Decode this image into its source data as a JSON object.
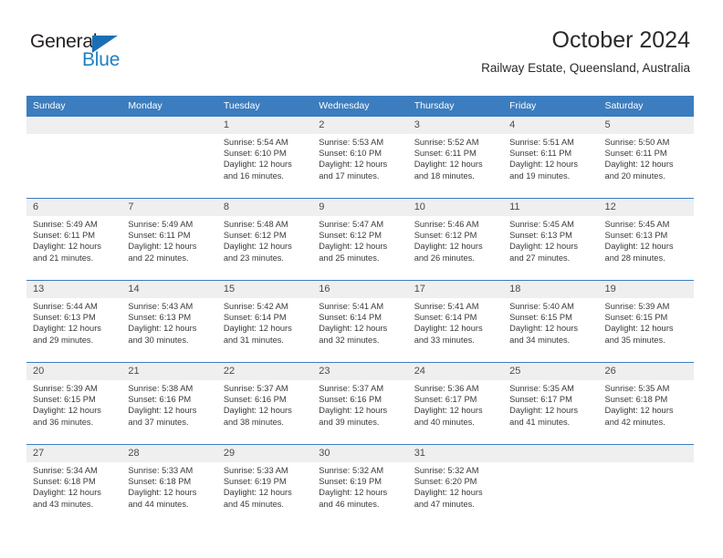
{
  "logo": {
    "word1": "General",
    "word2": "Blue",
    "triangle_color": "#1a6fb4",
    "word2_color": "#1f7fc4"
  },
  "header": {
    "title": "October 2024",
    "subtitle": "Railway Estate, Queensland, Australia"
  },
  "theme": {
    "header_bg": "#3c7dbf",
    "header_text": "#ffffff",
    "daynum_bg": "#efefef",
    "row_border": "#3c7dbf"
  },
  "weekdays": [
    "Sunday",
    "Monday",
    "Tuesday",
    "Wednesday",
    "Thursday",
    "Friday",
    "Saturday"
  ],
  "weeks": [
    [
      {
        "day": "",
        "lines": []
      },
      {
        "day": "",
        "lines": []
      },
      {
        "day": "1",
        "lines": [
          "Sunrise: 5:54 AM",
          "Sunset: 6:10 PM",
          "Daylight: 12 hours",
          "and 16 minutes."
        ]
      },
      {
        "day": "2",
        "lines": [
          "Sunrise: 5:53 AM",
          "Sunset: 6:10 PM",
          "Daylight: 12 hours",
          "and 17 minutes."
        ]
      },
      {
        "day": "3",
        "lines": [
          "Sunrise: 5:52 AM",
          "Sunset: 6:11 PM",
          "Daylight: 12 hours",
          "and 18 minutes."
        ]
      },
      {
        "day": "4",
        "lines": [
          "Sunrise: 5:51 AM",
          "Sunset: 6:11 PM",
          "Daylight: 12 hours",
          "and 19 minutes."
        ]
      },
      {
        "day": "5",
        "lines": [
          "Sunrise: 5:50 AM",
          "Sunset: 6:11 PM",
          "Daylight: 12 hours",
          "and 20 minutes."
        ]
      }
    ],
    [
      {
        "day": "6",
        "lines": [
          "Sunrise: 5:49 AM",
          "Sunset: 6:11 PM",
          "Daylight: 12 hours",
          "and 21 minutes."
        ]
      },
      {
        "day": "7",
        "lines": [
          "Sunrise: 5:49 AM",
          "Sunset: 6:11 PM",
          "Daylight: 12 hours",
          "and 22 minutes."
        ]
      },
      {
        "day": "8",
        "lines": [
          "Sunrise: 5:48 AM",
          "Sunset: 6:12 PM",
          "Daylight: 12 hours",
          "and 23 minutes."
        ]
      },
      {
        "day": "9",
        "lines": [
          "Sunrise: 5:47 AM",
          "Sunset: 6:12 PM",
          "Daylight: 12 hours",
          "and 25 minutes."
        ]
      },
      {
        "day": "10",
        "lines": [
          "Sunrise: 5:46 AM",
          "Sunset: 6:12 PM",
          "Daylight: 12 hours",
          "and 26 minutes."
        ]
      },
      {
        "day": "11",
        "lines": [
          "Sunrise: 5:45 AM",
          "Sunset: 6:13 PM",
          "Daylight: 12 hours",
          "and 27 minutes."
        ]
      },
      {
        "day": "12",
        "lines": [
          "Sunrise: 5:45 AM",
          "Sunset: 6:13 PM",
          "Daylight: 12 hours",
          "and 28 minutes."
        ]
      }
    ],
    [
      {
        "day": "13",
        "lines": [
          "Sunrise: 5:44 AM",
          "Sunset: 6:13 PM",
          "Daylight: 12 hours",
          "and 29 minutes."
        ]
      },
      {
        "day": "14",
        "lines": [
          "Sunrise: 5:43 AM",
          "Sunset: 6:13 PM",
          "Daylight: 12 hours",
          "and 30 minutes."
        ]
      },
      {
        "day": "15",
        "lines": [
          "Sunrise: 5:42 AM",
          "Sunset: 6:14 PM",
          "Daylight: 12 hours",
          "and 31 minutes."
        ]
      },
      {
        "day": "16",
        "lines": [
          "Sunrise: 5:41 AM",
          "Sunset: 6:14 PM",
          "Daylight: 12 hours",
          "and 32 minutes."
        ]
      },
      {
        "day": "17",
        "lines": [
          "Sunrise: 5:41 AM",
          "Sunset: 6:14 PM",
          "Daylight: 12 hours",
          "and 33 minutes."
        ]
      },
      {
        "day": "18",
        "lines": [
          "Sunrise: 5:40 AM",
          "Sunset: 6:15 PM",
          "Daylight: 12 hours",
          "and 34 minutes."
        ]
      },
      {
        "day": "19",
        "lines": [
          "Sunrise: 5:39 AM",
          "Sunset: 6:15 PM",
          "Daylight: 12 hours",
          "and 35 minutes."
        ]
      }
    ],
    [
      {
        "day": "20",
        "lines": [
          "Sunrise: 5:39 AM",
          "Sunset: 6:15 PM",
          "Daylight: 12 hours",
          "and 36 minutes."
        ]
      },
      {
        "day": "21",
        "lines": [
          "Sunrise: 5:38 AM",
          "Sunset: 6:16 PM",
          "Daylight: 12 hours",
          "and 37 minutes."
        ]
      },
      {
        "day": "22",
        "lines": [
          "Sunrise: 5:37 AM",
          "Sunset: 6:16 PM",
          "Daylight: 12 hours",
          "and 38 minutes."
        ]
      },
      {
        "day": "23",
        "lines": [
          "Sunrise: 5:37 AM",
          "Sunset: 6:16 PM",
          "Daylight: 12 hours",
          "and 39 minutes."
        ]
      },
      {
        "day": "24",
        "lines": [
          "Sunrise: 5:36 AM",
          "Sunset: 6:17 PM",
          "Daylight: 12 hours",
          "and 40 minutes."
        ]
      },
      {
        "day": "25",
        "lines": [
          "Sunrise: 5:35 AM",
          "Sunset: 6:17 PM",
          "Daylight: 12 hours",
          "and 41 minutes."
        ]
      },
      {
        "day": "26",
        "lines": [
          "Sunrise: 5:35 AM",
          "Sunset: 6:18 PM",
          "Daylight: 12 hours",
          "and 42 minutes."
        ]
      }
    ],
    [
      {
        "day": "27",
        "lines": [
          "Sunrise: 5:34 AM",
          "Sunset: 6:18 PM",
          "Daylight: 12 hours",
          "and 43 minutes."
        ]
      },
      {
        "day": "28",
        "lines": [
          "Sunrise: 5:33 AM",
          "Sunset: 6:18 PM",
          "Daylight: 12 hours",
          "and 44 minutes."
        ]
      },
      {
        "day": "29",
        "lines": [
          "Sunrise: 5:33 AM",
          "Sunset: 6:19 PM",
          "Daylight: 12 hours",
          "and 45 minutes."
        ]
      },
      {
        "day": "30",
        "lines": [
          "Sunrise: 5:32 AM",
          "Sunset: 6:19 PM",
          "Daylight: 12 hours",
          "and 46 minutes."
        ]
      },
      {
        "day": "31",
        "lines": [
          "Sunrise: 5:32 AM",
          "Sunset: 6:20 PM",
          "Daylight: 12 hours",
          "and 47 minutes."
        ]
      },
      {
        "day": "",
        "lines": []
      },
      {
        "day": "",
        "lines": []
      }
    ]
  ]
}
